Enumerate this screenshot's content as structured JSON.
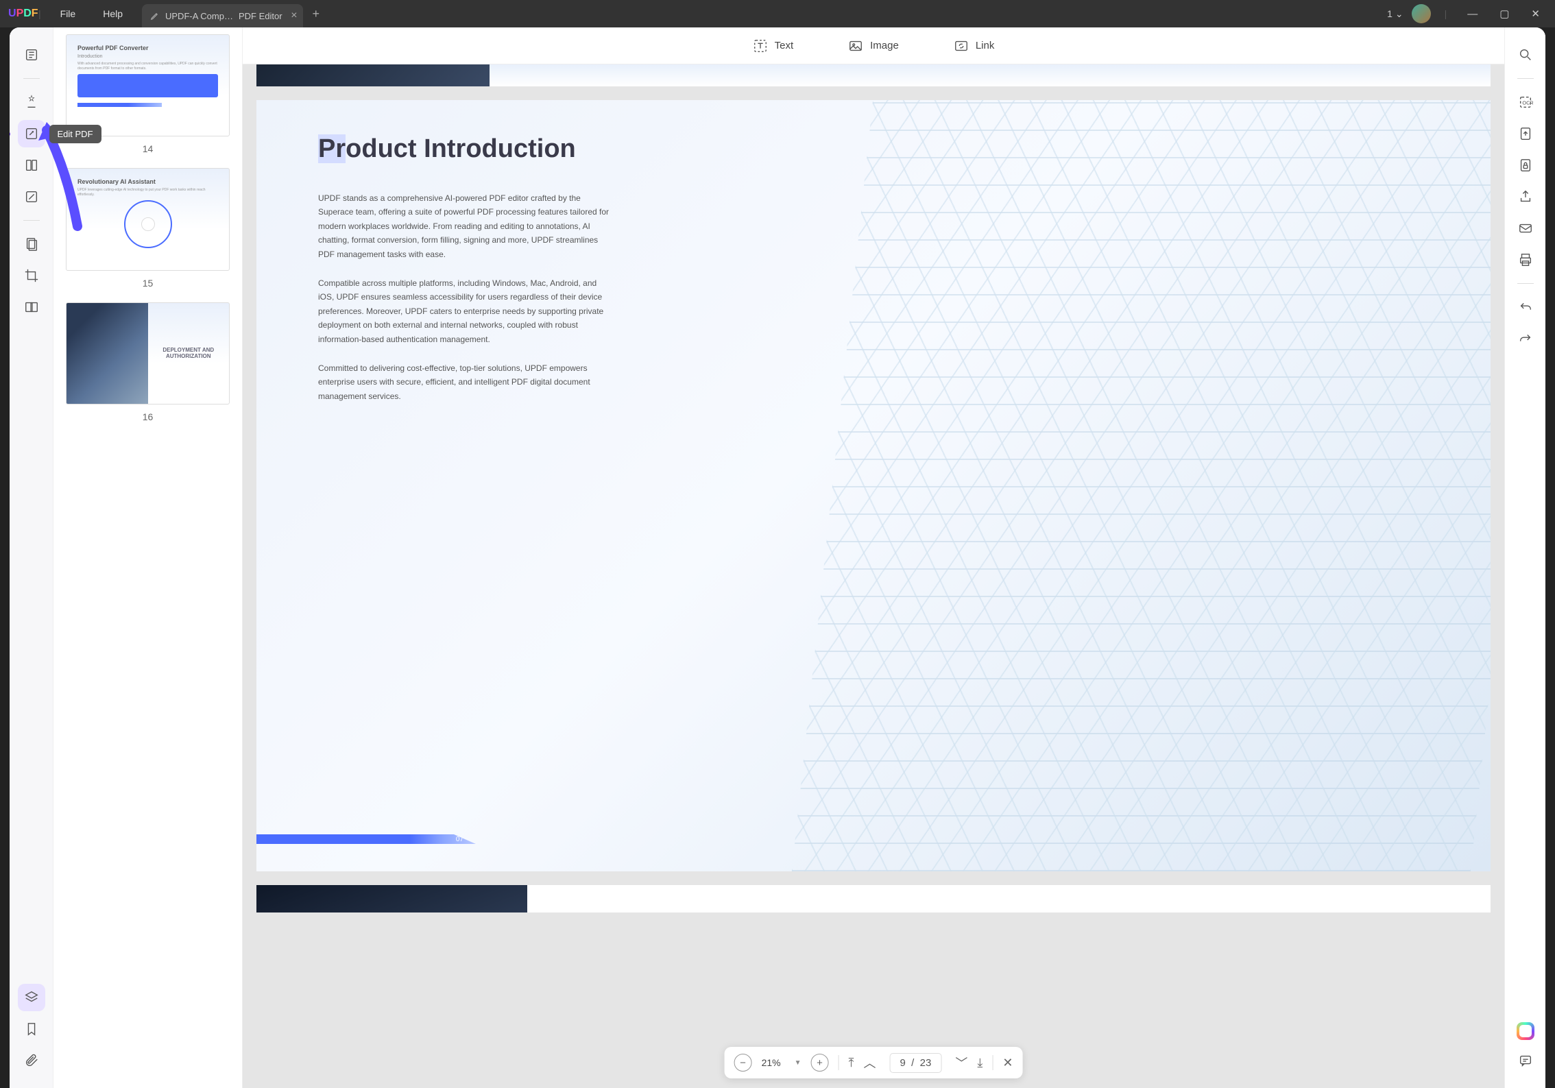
{
  "titlebar": {
    "menu_file": "File",
    "menu_help": "Help",
    "tab_title": "UPDF-A Comp…",
    "tab_suffix": "PDF Editor",
    "tab_count": "1"
  },
  "left_tools": {
    "tooltip_edit": "Edit PDF"
  },
  "edit_toolbar": {
    "text": "Text",
    "image": "Image",
    "link": "Link"
  },
  "thumbs": {
    "t14": {
      "num": "14",
      "title": "Powerful PDF Converter",
      "sub": "Introduction"
    },
    "t15": {
      "num": "15",
      "title": "Revolutionary AI Assistant"
    },
    "t16": {
      "num": "16",
      "caption": "DEPLOYMENT AND AUTHORIZATION"
    }
  },
  "page": {
    "h1a": "Pr",
    "h1b": "oduct Introduction",
    "p1": "UPDF stands as a comprehensive AI-powered PDF editor crafted by the Superace team, offering a suite of powerful PDF processing features tailored for modern workplaces worldwide. From reading and editing to annotations, AI chatting, format conversion, form filling, signing and more, UPDF streamlines PDF management tasks with ease.",
    "p2": "Compatible across multiple platforms, including Windows, Mac, Android, and iOS, UPDF ensures seamless accessibility for users regardless of their device preferences. Moreover, UPDF caters to enterprise needs by supporting private deployment on both external and internal networks, coupled with robust information-based authentication management.",
    "p3": "Committed to delivering cost-effective, top-tier solutions, UPDF empowers enterprise users with secure, efficient, and intelligent PDF digital document management services.",
    "pagenum": "07"
  },
  "bottom": {
    "zoom": "21%",
    "current": "9",
    "sep": "/",
    "total": "23"
  }
}
